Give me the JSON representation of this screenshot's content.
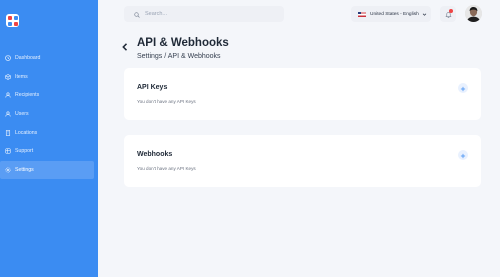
{
  "sidebar": {
    "items": [
      {
        "label": "Dashboard",
        "icon": "clock-icon",
        "active": false
      },
      {
        "label": "Items",
        "icon": "box-icon",
        "active": false
      },
      {
        "label": "Recipients",
        "icon": "user-icon",
        "active": false
      },
      {
        "label": "Users",
        "icon": "user-icon",
        "active": false
      },
      {
        "label": "Locations",
        "icon": "building-icon",
        "active": false
      },
      {
        "label": "Support",
        "icon": "support-icon",
        "active": false
      },
      {
        "label": "Settings",
        "icon": "gear-icon",
        "active": true
      }
    ]
  },
  "search": {
    "placeholder": "Search..."
  },
  "language": {
    "label": "United States - English"
  },
  "header": {
    "title": "API & Webhooks",
    "breadcrumb": "Settings / API & Webhooks"
  },
  "cards": {
    "api_keys": {
      "title": "API Keys",
      "empty": "You don't have any API Keys"
    },
    "webhooks": {
      "title": "Webhooks",
      "empty": "You don't have any API Keys"
    }
  },
  "colors": {
    "sidebar": "#3b8cf2",
    "sidebar_active": "#5a9df4",
    "accent": "#3b8cf2",
    "background": "#f4f6fa"
  }
}
